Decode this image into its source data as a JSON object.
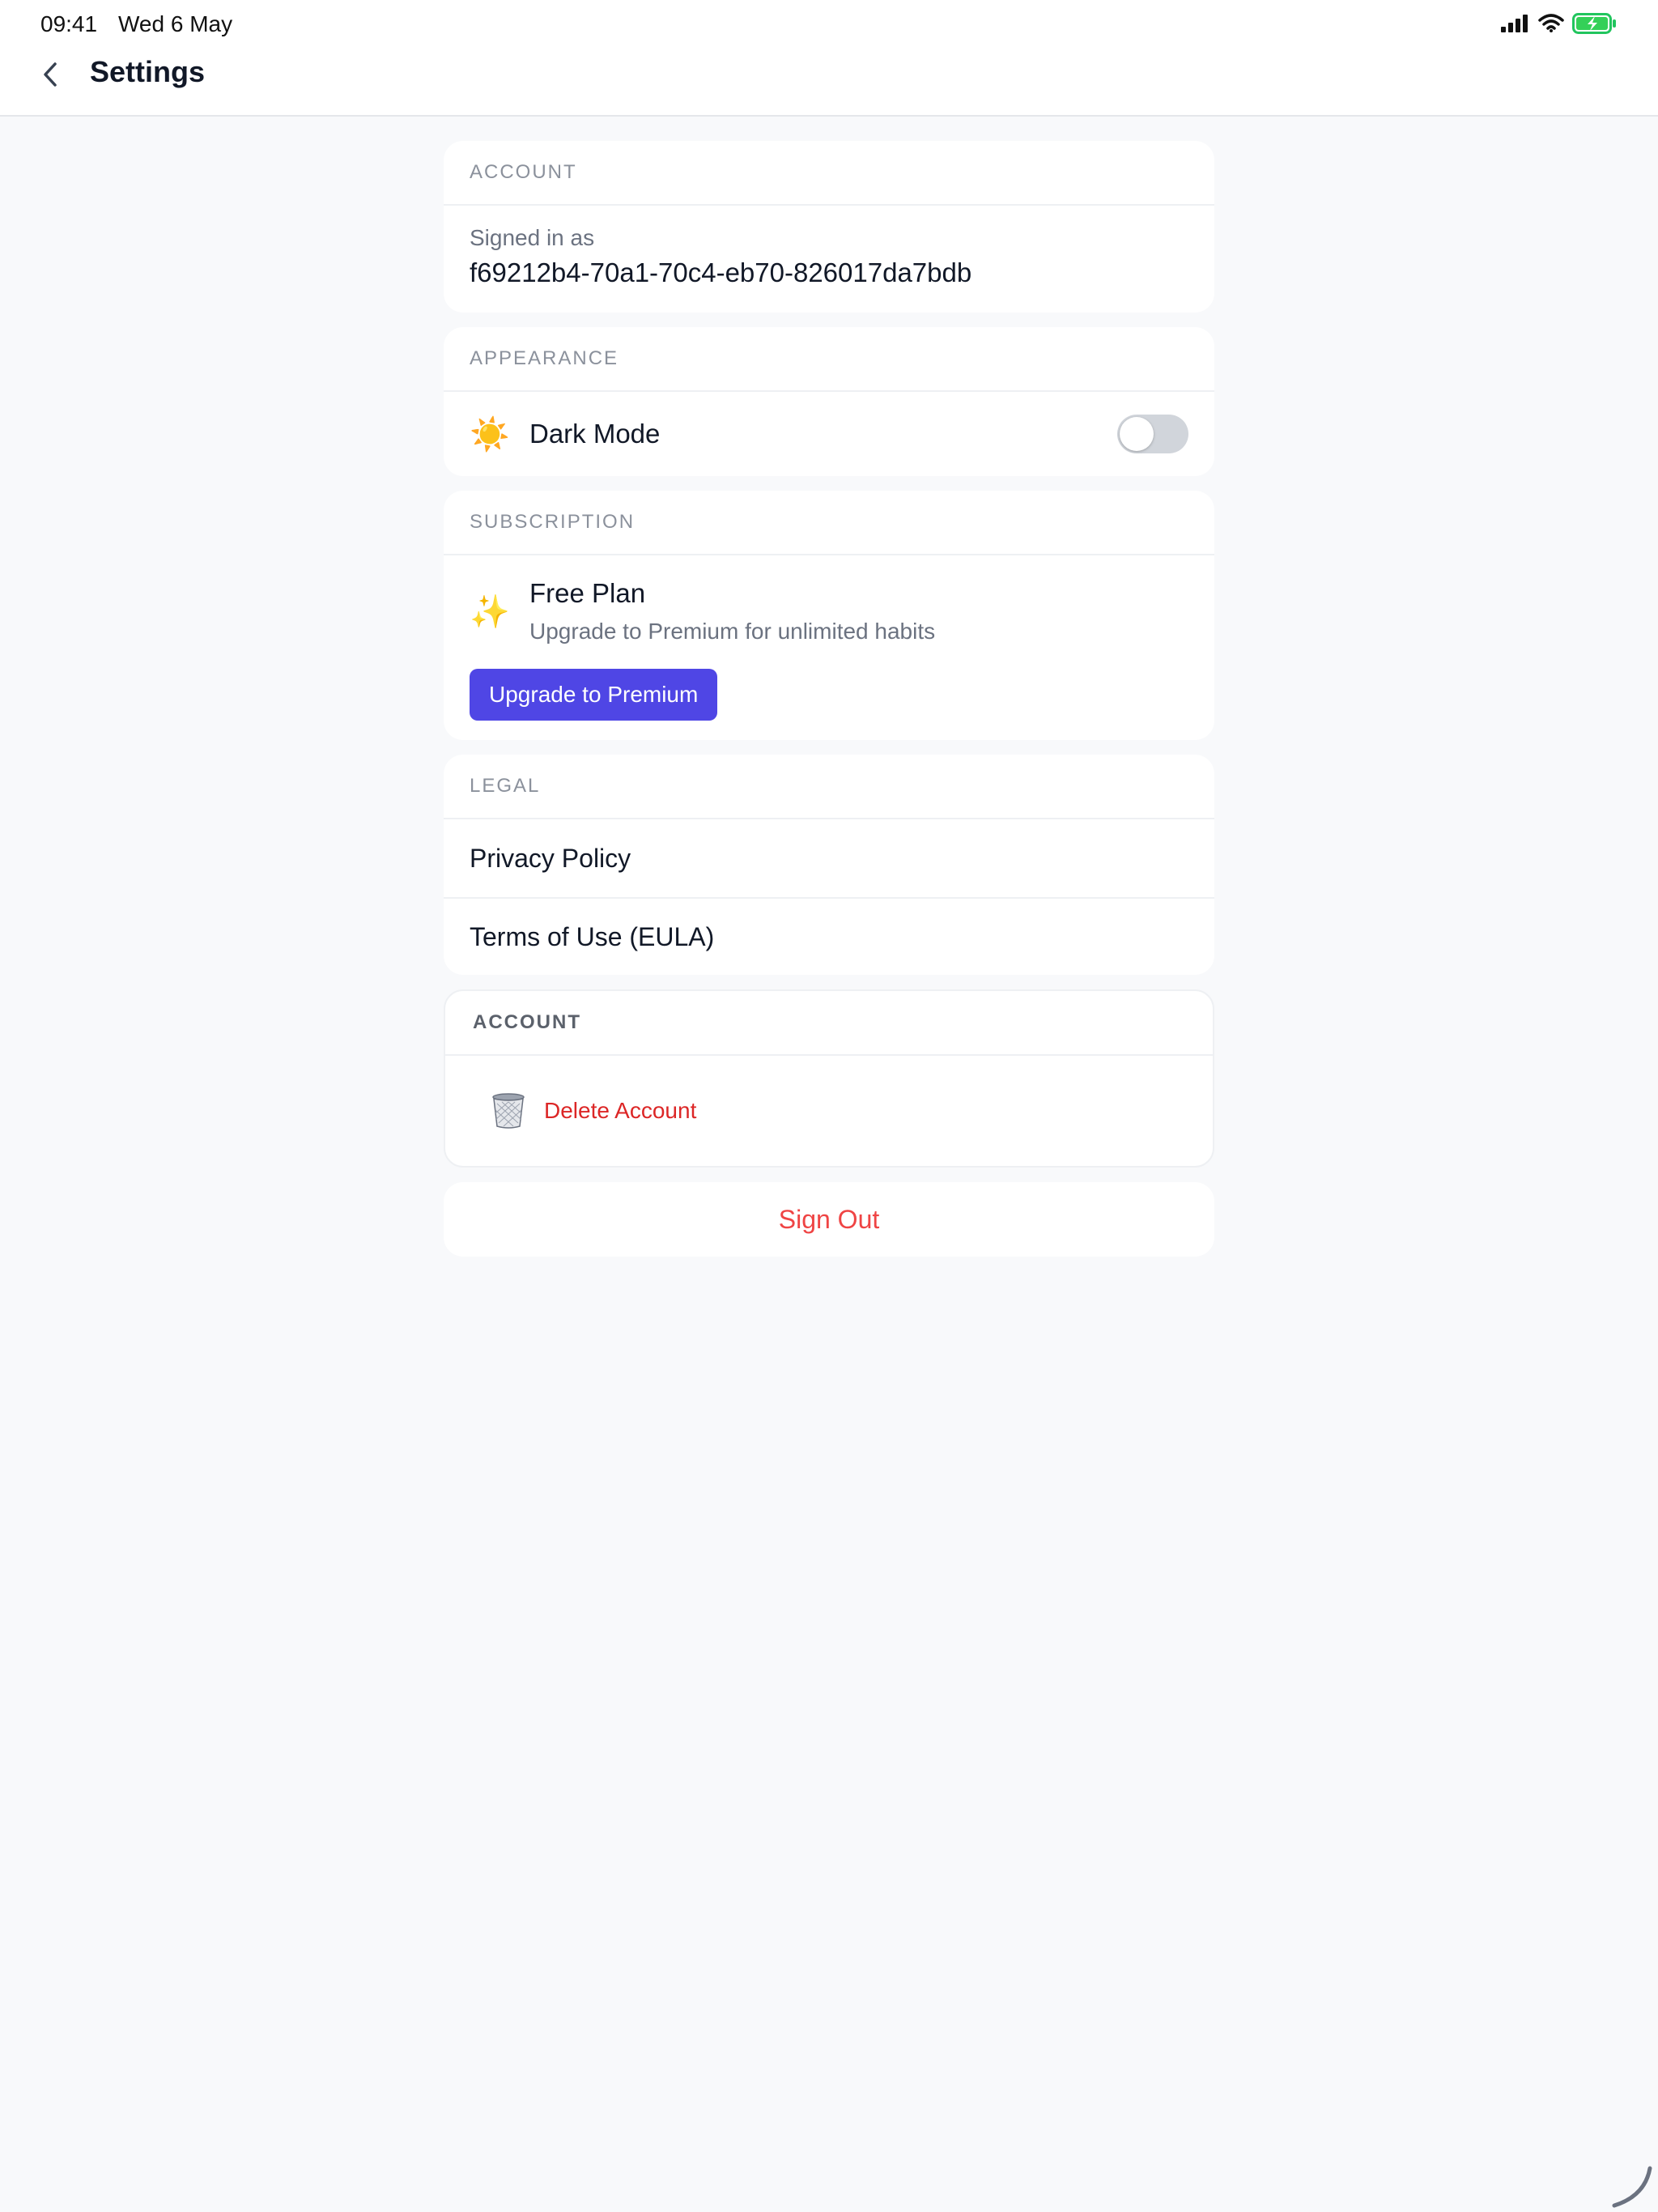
{
  "status_bar": {
    "time": "09:41",
    "date": "Wed 6 May",
    "icons": [
      "cellular-signal-icon",
      "wifi-icon",
      "battery-charging-icon"
    ]
  },
  "nav": {
    "back_icon": "chevron-left-icon",
    "title": "Settings"
  },
  "account_section": {
    "header": "ACCOUNT",
    "signed_in_label": "Signed in as",
    "signed_in_value": "f69212b4-70a1-70c4-eb70-826017da7bdb"
  },
  "appearance_section": {
    "header": "APPEARANCE",
    "emoji": "☀️",
    "dark_mode_label": "Dark Mode",
    "dark_mode_enabled": false
  },
  "subscription_section": {
    "header": "SUBSCRIPTION",
    "emoji": "✨",
    "plan_title": "Free Plan",
    "plan_subtitle": "Upgrade to Premium for unlimited habits",
    "upgrade_button": "Upgrade to Premium"
  },
  "legal_section": {
    "header": "LEGAL",
    "items": [
      "Privacy Policy",
      "Terms of Use (EULA)"
    ]
  },
  "danger_section": {
    "header": "ACCOUNT",
    "delete_icon": "trash-icon",
    "delete_label": "Delete Account"
  },
  "sign_out_label": "Sign Out",
  "colors": {
    "accent": "#4f46e5",
    "danger": "#dc2626",
    "background": "#f8f9fb"
  }
}
